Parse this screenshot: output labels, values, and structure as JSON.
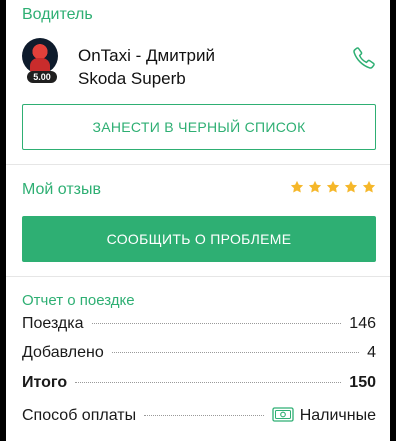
{
  "driver": {
    "section_title": "Водитель",
    "name": "OnTaxi - Дмитрий",
    "car": "Skoda Superb",
    "rating": "5.00",
    "blacklist_label": "ЗАНЕСТИ В ЧЕРНЫЙ СПИСОК"
  },
  "review": {
    "title": "Мой отзыв",
    "stars": 5,
    "report_problem_label": "СООБЩИТЬ О ПРОБЛЕМЕ"
  },
  "trip_report": {
    "title": "Отчет о поездке",
    "rows": [
      {
        "label": "Поездка",
        "value": "146"
      },
      {
        "label": "Добавлено",
        "value": "4"
      },
      {
        "label": "Итого",
        "value": "150"
      }
    ],
    "payment_label": "Способ оплаты",
    "payment_value": "Наличные"
  },
  "colors": {
    "accent": "#2eaf73",
    "star": "#f5b72a"
  },
  "icons": {
    "phone": "phone-icon",
    "star": "star-icon",
    "payment": "cash-icon"
  }
}
